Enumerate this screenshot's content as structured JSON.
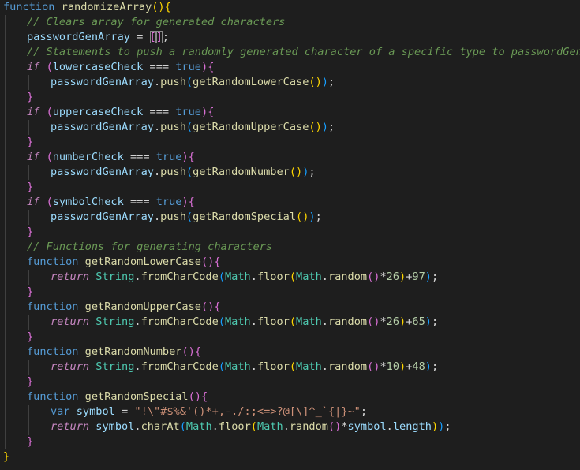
{
  "editor": {
    "background": "#1e1e1e",
    "lines": [
      {
        "indent": 0,
        "tokens": [
          [
            "keyword",
            "function"
          ],
          [
            "plain",
            " "
          ],
          [
            "func",
            "randomizeArray"
          ],
          [
            "bracket1",
            "()"
          ],
          [
            "bracket1",
            "{"
          ]
        ]
      },
      {
        "indent": 1,
        "tokens": [
          [
            "comment",
            "// Clears array for generated characters"
          ]
        ]
      },
      {
        "indent": 1,
        "tokens": [
          [
            "var",
            "passwordGenArray"
          ],
          [
            "op",
            " = "
          ],
          [
            "bracket2",
            "["
          ],
          [
            "cursor",
            ""
          ],
          [
            "bracket2",
            "]"
          ],
          [
            "punct",
            ";"
          ]
        ]
      },
      {
        "indent": 1,
        "tokens": [
          [
            "comment",
            "// Statements to push a randomly generated character of a specific type to passwordGenArray"
          ]
        ]
      },
      {
        "indent": 1,
        "tokens": [
          [
            "control",
            "if"
          ],
          [
            "plain",
            " "
          ],
          [
            "bracket2",
            "("
          ],
          [
            "var",
            "lowercaseCheck"
          ],
          [
            "op",
            " === "
          ],
          [
            "bool",
            "true"
          ],
          [
            "bracket2",
            ")"
          ],
          [
            "bracket2",
            "{"
          ]
        ]
      },
      {
        "indent": 2,
        "tokens": [
          [
            "var",
            "passwordGenArray"
          ],
          [
            "punct",
            "."
          ],
          [
            "method",
            "push"
          ],
          [
            "bracket3",
            "("
          ],
          [
            "func",
            "getRandomLowerCase"
          ],
          [
            "bracket1",
            "()"
          ],
          [
            "bracket3",
            ")"
          ],
          [
            "punct",
            ";"
          ]
        ]
      },
      {
        "indent": 1,
        "tokens": [
          [
            "bracket2",
            "}"
          ]
        ]
      },
      {
        "indent": 1,
        "tokens": [
          [
            "control",
            "if"
          ],
          [
            "plain",
            " "
          ],
          [
            "bracket2",
            "("
          ],
          [
            "var",
            "uppercaseCheck"
          ],
          [
            "op",
            " === "
          ],
          [
            "bool",
            "true"
          ],
          [
            "bracket2",
            ")"
          ],
          [
            "bracket2",
            "{"
          ]
        ]
      },
      {
        "indent": 2,
        "tokens": [
          [
            "var",
            "passwordGenArray"
          ],
          [
            "punct",
            "."
          ],
          [
            "method",
            "push"
          ],
          [
            "bracket3",
            "("
          ],
          [
            "func",
            "getRandomUpperCase"
          ],
          [
            "bracket1",
            "()"
          ],
          [
            "bracket3",
            ")"
          ],
          [
            "punct",
            ";"
          ]
        ]
      },
      {
        "indent": 1,
        "tokens": [
          [
            "bracket2",
            "}"
          ]
        ]
      },
      {
        "indent": 1,
        "tokens": [
          [
            "control",
            "if"
          ],
          [
            "plain",
            " "
          ],
          [
            "bracket2",
            "("
          ],
          [
            "var",
            "numberCheck"
          ],
          [
            "op",
            " === "
          ],
          [
            "bool",
            "true"
          ],
          [
            "bracket2",
            ")"
          ],
          [
            "bracket2",
            "{"
          ]
        ]
      },
      {
        "indent": 2,
        "tokens": [
          [
            "var",
            "passwordGenArray"
          ],
          [
            "punct",
            "."
          ],
          [
            "method",
            "push"
          ],
          [
            "bracket3",
            "("
          ],
          [
            "func",
            "getRandomNumber"
          ],
          [
            "bracket1",
            "()"
          ],
          [
            "bracket3",
            ")"
          ],
          [
            "punct",
            ";"
          ]
        ]
      },
      {
        "indent": 1,
        "tokens": [
          [
            "bracket2",
            "}"
          ]
        ]
      },
      {
        "indent": 1,
        "tokens": [
          [
            "control",
            "if"
          ],
          [
            "plain",
            " "
          ],
          [
            "bracket2",
            "("
          ],
          [
            "var",
            "symbolCheck"
          ],
          [
            "op",
            " === "
          ],
          [
            "bool",
            "true"
          ],
          [
            "bracket2",
            ")"
          ],
          [
            "bracket2",
            "{"
          ]
        ]
      },
      {
        "indent": 2,
        "tokens": [
          [
            "var",
            "passwordGenArray"
          ],
          [
            "punct",
            "."
          ],
          [
            "method",
            "push"
          ],
          [
            "bracket3",
            "("
          ],
          [
            "func",
            "getRandomSpecial"
          ],
          [
            "bracket1",
            "()"
          ],
          [
            "bracket3",
            ")"
          ],
          [
            "punct",
            ";"
          ]
        ]
      },
      {
        "indent": 1,
        "tokens": [
          [
            "bracket2",
            "}"
          ]
        ]
      },
      {
        "indent": 1,
        "tokens": [
          [
            "comment",
            "// Functions for generating characters"
          ]
        ]
      },
      {
        "indent": 1,
        "tokens": [
          [
            "keyword",
            "function"
          ],
          [
            "plain",
            " "
          ],
          [
            "func",
            "getRandomLowerCase"
          ],
          [
            "bracket2",
            "()"
          ],
          [
            "bracket2",
            "{"
          ]
        ]
      },
      {
        "indent": 2,
        "tokens": [
          [
            "control",
            "return"
          ],
          [
            "plain",
            " "
          ],
          [
            "class",
            "String"
          ],
          [
            "punct",
            "."
          ],
          [
            "method",
            "fromCharCode"
          ],
          [
            "bracket3",
            "("
          ],
          [
            "class",
            "Math"
          ],
          [
            "punct",
            "."
          ],
          [
            "method",
            "floor"
          ],
          [
            "bracket1",
            "("
          ],
          [
            "class",
            "Math"
          ],
          [
            "punct",
            "."
          ],
          [
            "method",
            "random"
          ],
          [
            "bracket2",
            "()"
          ],
          [
            "op",
            "*"
          ],
          [
            "number",
            "26"
          ],
          [
            "bracket1",
            ")"
          ],
          [
            "op",
            "+"
          ],
          [
            "number",
            "97"
          ],
          [
            "bracket3",
            ")"
          ],
          [
            "punct",
            ";"
          ]
        ]
      },
      {
        "indent": 1,
        "tokens": [
          [
            "bracket2",
            "}"
          ]
        ]
      },
      {
        "indent": 1,
        "tokens": [
          [
            "keyword",
            "function"
          ],
          [
            "plain",
            " "
          ],
          [
            "func",
            "getRandomUpperCase"
          ],
          [
            "bracket2",
            "()"
          ],
          [
            "bracket2",
            "{"
          ]
        ]
      },
      {
        "indent": 2,
        "tokens": [
          [
            "control",
            "return"
          ],
          [
            "plain",
            " "
          ],
          [
            "class",
            "String"
          ],
          [
            "punct",
            "."
          ],
          [
            "method",
            "fromCharCode"
          ],
          [
            "bracket3",
            "("
          ],
          [
            "class",
            "Math"
          ],
          [
            "punct",
            "."
          ],
          [
            "method",
            "floor"
          ],
          [
            "bracket1",
            "("
          ],
          [
            "class",
            "Math"
          ],
          [
            "punct",
            "."
          ],
          [
            "method",
            "random"
          ],
          [
            "bracket2",
            "()"
          ],
          [
            "op",
            "*"
          ],
          [
            "number",
            "26"
          ],
          [
            "bracket1",
            ")"
          ],
          [
            "op",
            "+"
          ],
          [
            "number",
            "65"
          ],
          [
            "bracket3",
            ")"
          ],
          [
            "punct",
            ";"
          ]
        ]
      },
      {
        "indent": 1,
        "tokens": [
          [
            "bracket2",
            "}"
          ]
        ]
      },
      {
        "indent": 1,
        "tokens": [
          [
            "keyword",
            "function"
          ],
          [
            "plain",
            " "
          ],
          [
            "func",
            "getRandomNumber"
          ],
          [
            "bracket2",
            "()"
          ],
          [
            "bracket2",
            "{"
          ]
        ]
      },
      {
        "indent": 2,
        "tokens": [
          [
            "control",
            "return"
          ],
          [
            "plain",
            " "
          ],
          [
            "class",
            "String"
          ],
          [
            "punct",
            "."
          ],
          [
            "method",
            "fromCharCode"
          ],
          [
            "bracket3",
            "("
          ],
          [
            "class",
            "Math"
          ],
          [
            "punct",
            "."
          ],
          [
            "method",
            "floor"
          ],
          [
            "bracket1",
            "("
          ],
          [
            "class",
            "Math"
          ],
          [
            "punct",
            "."
          ],
          [
            "method",
            "random"
          ],
          [
            "bracket2",
            "()"
          ],
          [
            "op",
            "*"
          ],
          [
            "number",
            "10"
          ],
          [
            "bracket1",
            ")"
          ],
          [
            "op",
            "+"
          ],
          [
            "number",
            "48"
          ],
          [
            "bracket3",
            ")"
          ],
          [
            "punct",
            ";"
          ]
        ]
      },
      {
        "indent": 1,
        "tokens": [
          [
            "bracket2",
            "}"
          ]
        ]
      },
      {
        "indent": 1,
        "tokens": [
          [
            "keyword",
            "function"
          ],
          [
            "plain",
            " "
          ],
          [
            "func",
            "getRandomSpecial"
          ],
          [
            "bracket2",
            "()"
          ],
          [
            "bracket2",
            "{"
          ]
        ]
      },
      {
        "indent": 2,
        "tokens": [
          [
            "keyword",
            "var"
          ],
          [
            "plain",
            " "
          ],
          [
            "var",
            "symbol"
          ],
          [
            "op",
            " = "
          ],
          [
            "string",
            "\"!\\\"#$%&'()*+,-./:;<=>?@[\\]^_`{|}~\""
          ],
          [
            "punct",
            ";"
          ]
        ]
      },
      {
        "indent": 2,
        "tokens": [
          [
            "control",
            "return"
          ],
          [
            "plain",
            " "
          ],
          [
            "var",
            "symbol"
          ],
          [
            "punct",
            "."
          ],
          [
            "method",
            "charAt"
          ],
          [
            "bracket3",
            "("
          ],
          [
            "class",
            "Math"
          ],
          [
            "punct",
            "."
          ],
          [
            "method",
            "floor"
          ],
          [
            "bracket1",
            "("
          ],
          [
            "class",
            "Math"
          ],
          [
            "punct",
            "."
          ],
          [
            "method",
            "random"
          ],
          [
            "bracket2",
            "()"
          ],
          [
            "op",
            "*"
          ],
          [
            "var",
            "symbol"
          ],
          [
            "punct",
            "."
          ],
          [
            "var",
            "length"
          ],
          [
            "bracket1",
            ")"
          ],
          [
            "bracket3",
            ")"
          ],
          [
            "punct",
            ";"
          ]
        ]
      },
      {
        "indent": 1,
        "tokens": [
          [
            "bracket2",
            "}"
          ]
        ]
      },
      {
        "indent": 0,
        "tokens": [
          [
            "bracket1",
            "}"
          ]
        ]
      }
    ]
  }
}
